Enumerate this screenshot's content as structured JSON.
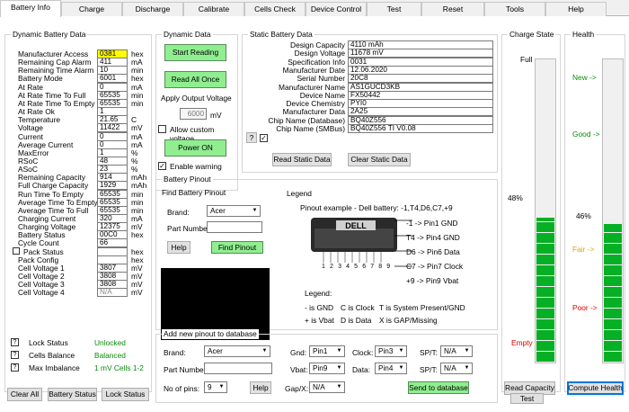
{
  "tabs": [
    "Battery Info",
    "Charge",
    "Discharge",
    "Calibrate",
    "Cells Check",
    "Device Control",
    "Test",
    "Reset",
    "Tools",
    "Help"
  ],
  "dynamic": {
    "title": "Dynamic Battery Data",
    "rows": [
      {
        "label": "Manufacturer Access",
        "value": "0381",
        "unit": "hex",
        "highlight": true
      },
      {
        "label": "Remaining Cap Alarm",
        "value": "411",
        "unit": "mA"
      },
      {
        "label": "Remaining Time Alarm",
        "value": "10",
        "unit": "min"
      },
      {
        "label": "Battery Mode",
        "value": "6001",
        "unit": "hex"
      },
      {
        "label": "At Rate",
        "value": "0",
        "unit": "mA"
      },
      {
        "label": "At Rate Time To Full",
        "value": "65535",
        "unit": "min"
      },
      {
        "label": "At Rate Time To Empty",
        "value": "65535",
        "unit": "min"
      },
      {
        "label": "At Rate Ok",
        "value": "1",
        "unit": ""
      },
      {
        "label": "Temperature",
        "value": "21.65",
        "unit": "C"
      },
      {
        "label": "Voltage",
        "value": "11422",
        "unit": "mV"
      },
      {
        "label": "Current",
        "value": "0",
        "unit": "mA"
      },
      {
        "label": "Average Current",
        "value": "0",
        "unit": "mA"
      },
      {
        "label": "MaxError",
        "value": "1",
        "unit": "%"
      },
      {
        "label": "RSoC",
        "value": "48",
        "unit": "%"
      },
      {
        "label": "ASoC",
        "value": "23",
        "unit": "%"
      },
      {
        "label": "Remaining Capacity",
        "value": "914",
        "unit": "mAh"
      },
      {
        "label": "Full Charge Capacity",
        "value": "1929",
        "unit": "mAh"
      },
      {
        "label": "Run Time To Empty",
        "value": "65535",
        "unit": "min"
      },
      {
        "label": "Average Time To Empty",
        "value": "65535",
        "unit": "min"
      },
      {
        "label": "Average Time To Full",
        "value": "65535",
        "unit": "min"
      },
      {
        "label": "Charging Current",
        "value": "320",
        "unit": "mA"
      },
      {
        "label": "Charging Voltage",
        "value": "12375",
        "unit": "mV"
      },
      {
        "label": "Battery Status",
        "value": "00C0",
        "unit": "hex"
      },
      {
        "label": "Cycle Count",
        "value": "66",
        "unit": ""
      },
      {
        "label": "Pack Status",
        "value": "",
        "unit": "hex",
        "checkbox": true
      },
      {
        "label": "Pack Config",
        "value": "",
        "unit": "hex"
      },
      {
        "label": "Cell Voltage 1",
        "value": "3807",
        "unit": "mV"
      },
      {
        "label": "Cell Voltage 2",
        "value": "3808",
        "unit": "mV"
      },
      {
        "label": "Cell Voltage 3",
        "value": "3808",
        "unit": "mV"
      },
      {
        "label": "Cell Voltage 4",
        "value": "N/A",
        "unit": "mV"
      }
    ],
    "lock_label": "Lock Status",
    "lock_value": "Unlocked",
    "balance_label": "Cells Balance",
    "balance_value": "Balanced",
    "imbalance_label": "Max Imbalance",
    "imbalance_value": "1 mV Cells 1-2",
    "help_q": "?"
  },
  "buttons": {
    "clear_all": "Clear All",
    "battery_status": "Battery Status",
    "lock_status": "Lock Status"
  },
  "dyn_data": {
    "title": "Dynamic Data",
    "start_reading": "Start Reading",
    "read_all_once": "Read All Once",
    "apply_voltage": "Apply Output Voltage",
    "voltage_value": "6000",
    "voltage_unit": "mV",
    "allow_custom": "Allow custom voltage",
    "power_on": "Power ON",
    "enable_warning": "Enable warning"
  },
  "static": {
    "title": "Static Battery Data",
    "rows": [
      {
        "label": "Design Capacity",
        "value": "4110 mAh"
      },
      {
        "label": "Design Voltage",
        "value": "11678 mV"
      },
      {
        "label": "Specification Info",
        "value": "0031"
      },
      {
        "label": "Manufacturer Date",
        "value": "12.06.2020"
      },
      {
        "label": "Serial Number",
        "value": "20C8"
      },
      {
        "label": "Manufacturer Name",
        "value": "AS1GUCD3KB"
      },
      {
        "label": "Device Name",
        "value": "FX50442"
      },
      {
        "label": "Device Chemistry",
        "value": "PYI0"
      },
      {
        "label": "Manufacturer Data",
        "value": "2A25"
      },
      {
        "label": "Chip Name (Database)",
        "value": "BQ40Z556"
      },
      {
        "label": "Chip Name (SMBus)",
        "value": "BQ40Z556 TI V0.08"
      }
    ],
    "read_btn": "Read Static Data",
    "clear_btn": "Clear Static Data",
    "help_q": "?"
  },
  "charge_state": {
    "title": "Charge State",
    "full": "Full",
    "empty": "Empty",
    "percent_label": "48%",
    "level": 0.48,
    "read_btn": "Read Capacity",
    "test_btn": "Test"
  },
  "health": {
    "title": "Health",
    "new": "New ->",
    "good": "Good ->",
    "fair": "Fair ->",
    "poor": "Poor ->",
    "percent_label": "46%",
    "level": 0.46,
    "compute_btn": "Compute Health"
  },
  "pinout": {
    "title": "Battery Pinout",
    "find_title": "Find Battery Pinout",
    "brand_label": "Brand:",
    "brand_value": "Acer",
    "part_label": "Part Number:",
    "help_btn": "Help",
    "find_btn": "Find Pinout",
    "legend_title": "Legend",
    "example": "Pinout example - Dell battery:  -1,T4,D6,C7,+9",
    "dell": "DELL",
    "pin_numbers": "1 2 3 4 5 6 7 8 9",
    "pin_lines": [
      "-1 -> Pin1 GND",
      "T4 -> Pin4 GND",
      "D6 -> Pin6 Data",
      "C7 -> Pin7 Clock",
      "+9 -> Pin9 Vbat"
    ],
    "legend_label": "Legend:",
    "legend_rows": [
      [
        "- is GND",
        "C is Clock",
        "T is System Present/GND"
      ],
      [
        "+ is Vbat",
        "D is Data",
        "X is GAP/Missing"
      ]
    ]
  },
  "add_pinout": {
    "title": "Add new pinout to database",
    "brand_label": "Brand:",
    "brand_value": "Acer",
    "part_label": "Part Number:",
    "pins_label": "No of pins:",
    "pins_value": "9",
    "help_btn": "Help",
    "gnd_label": "Gnd:",
    "gnd_value": "Pin1",
    "vbat_label": "Vbat:",
    "vbat_value": "Pin9",
    "gapx_label": "Gap/X:",
    "gapx_value": "N/A",
    "clock_label": "Clock:",
    "clock_value": "Pin3",
    "data_label": "Data:",
    "data_value": "Pin4",
    "spt_label": "SP/T:",
    "spt1_value": "N/A",
    "spt2_value": "N/A",
    "send_btn": "Send to database"
  }
}
